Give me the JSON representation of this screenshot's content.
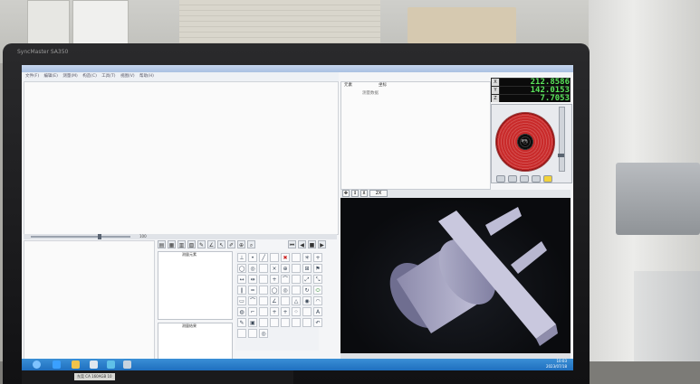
{
  "monitor": {
    "brand": "SyncMaster SA350"
  },
  "menubar": {
    "items": [
      "文件(F)",
      "编辑(E)",
      "测量(M)",
      "构造(C)",
      "工具(T)",
      "视图(V)",
      "帮助(H)"
    ]
  },
  "slider": {
    "value": "100"
  },
  "panels": {
    "upper_label": "测量元素",
    "lower_label": "测量结果"
  },
  "infopanel": {
    "tab_a": "元素",
    "tab_b": "坐标",
    "field": "测量数据"
  },
  "dro": {
    "x_label": "X",
    "y_label": "Y",
    "z_label": "Z",
    "x": "212.8586",
    "y": "142.0153",
    "z": "7.7053"
  },
  "light": {
    "center_label": "环光"
  },
  "camera": {
    "zoom": "2X"
  },
  "tray": {
    "time": "10:03",
    "date": "2023/07/18"
  },
  "taskbar_strip": {
    "item1": "东莞 CA 160AGB 10"
  }
}
